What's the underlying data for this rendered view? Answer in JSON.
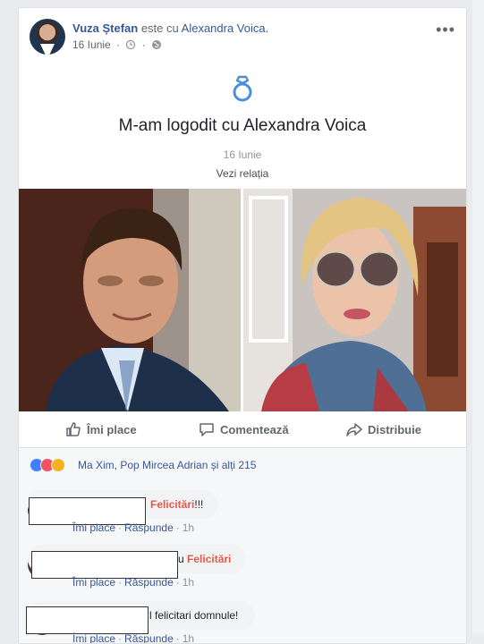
{
  "post": {
    "author": "Vuza Ștefan",
    "with_text": "este cu",
    "tagged": "Alexandra Voica.",
    "date": "16 Iunie",
    "more": "•••",
    "event": {
      "title": "M-am logodit cu Alexandra Voica",
      "date": "16 Iunie",
      "link": "Vezi relația"
    },
    "actions": {
      "like": "Îmi place",
      "comment": "Comentează",
      "share": "Distribuie"
    },
    "reactions": {
      "text": "Ma Xim, Pop Mircea Adrian și alți 215"
    }
  },
  "comments": [
    {
      "text": "Felicitări",
      "suffix": "!!!",
      "actions": [
        "Îmi place",
        "Răspunde"
      ],
      "time": "1h"
    },
    {
      "text": "u ",
      "highlight": "Felicitări",
      "actions": [
        "Îmi place",
        "Răspunde"
      ],
      "time": "1h"
    },
    {
      "text": "l felicitari domnule!",
      "actions": [
        "Îmi place",
        "Răspunde"
      ],
      "time": "1h"
    }
  ],
  "colors": {
    "link": "#365899",
    "highlight": "#e9594a",
    "muted": "#606770"
  }
}
